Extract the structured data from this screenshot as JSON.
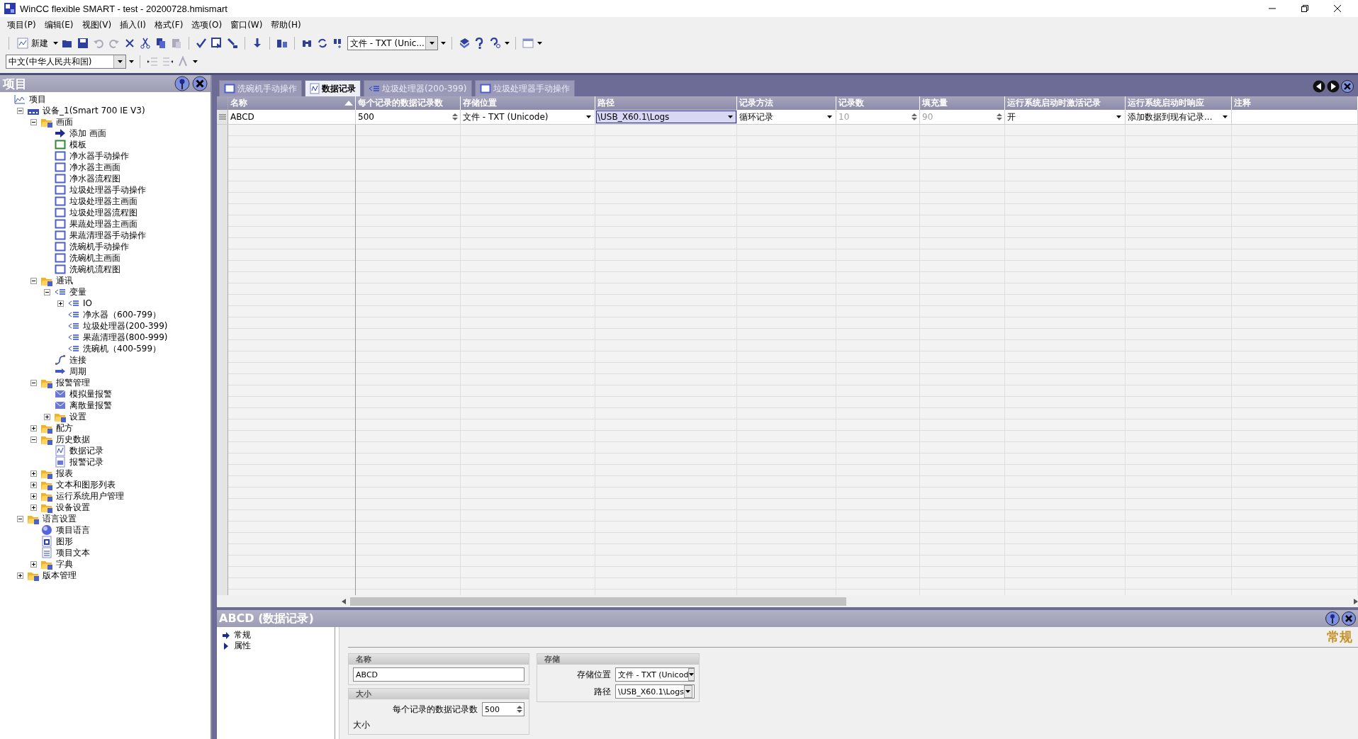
{
  "window": {
    "title": "WinCC flexible SMART - test - 20200728.hmismart"
  },
  "menu": [
    "项目(P)",
    "编辑(E)",
    "视图(V)",
    "插入(I)",
    "格式(F)",
    "选项(O)",
    "窗口(W)",
    "帮助(H)"
  ],
  "toolbar": {
    "new_label": "新建",
    "storage_combo": "文件 - TXT (Unic...",
    "language_combo": "中文(中华人民共和国)"
  },
  "project_panel": {
    "title": "项目",
    "tree": [
      {
        "label": "项目",
        "kind": "project",
        "children": [
          {
            "label": "设备_1(Smart 700 IE V3)",
            "kind": "device",
            "expanded": true,
            "children": [
              {
                "label": "画面",
                "kind": "folder",
                "expanded": true,
                "children": [
                  {
                    "label": "添加 画面",
                    "kind": "add"
                  },
                  {
                    "label": "模板",
                    "kind": "template"
                  },
                  {
                    "label": "净水器手动操作",
                    "kind": "screen"
                  },
                  {
                    "label": "净水器主画面",
                    "kind": "screen"
                  },
                  {
                    "label": "净水器流程图",
                    "kind": "screen"
                  },
                  {
                    "label": "垃圾处理器手动操作",
                    "kind": "screen"
                  },
                  {
                    "label": "垃圾处理器主画面",
                    "kind": "screen"
                  },
                  {
                    "label": "垃圾处理器流程图",
                    "kind": "screen"
                  },
                  {
                    "label": "果蔬处理器主画面",
                    "kind": "screen"
                  },
                  {
                    "label": "果蔬清理器手动操作",
                    "kind": "screen"
                  },
                  {
                    "label": "洗碗机手动操作",
                    "kind": "screen"
                  },
                  {
                    "label": "洗碗机主画面",
                    "kind": "screen"
                  },
                  {
                    "label": "洗碗机流程图",
                    "kind": "screen"
                  }
                ]
              },
              {
                "label": "通讯",
                "kind": "folder",
                "expanded": true,
                "children": [
                  {
                    "label": "变量",
                    "kind": "tags",
                    "expanded": true,
                    "children": [
                      {
                        "label": "IO",
                        "kind": "tags",
                        "expanded": false
                      },
                      {
                        "label": "净水器（600-799）",
                        "kind": "tags"
                      },
                      {
                        "label": "垃圾处理器(200-399)",
                        "kind": "tags"
                      },
                      {
                        "label": "果蔬清理器(800-999)",
                        "kind": "tags"
                      },
                      {
                        "label": "洗碗机（400-599）",
                        "kind": "tags"
                      }
                    ]
                  },
                  {
                    "label": "连接",
                    "kind": "connection"
                  },
                  {
                    "label": "周期",
                    "kind": "cycle"
                  }
                ]
              },
              {
                "label": "报警管理",
                "kind": "folder",
                "expanded": true,
                "children": [
                  {
                    "label": "模拟量报警",
                    "kind": "alarm"
                  },
                  {
                    "label": "离散量报警",
                    "kind": "alarm"
                  },
                  {
                    "label": "设置",
                    "kind": "folder",
                    "expanded": false
                  }
                ]
              },
              {
                "label": "配方",
                "kind": "folder",
                "expanded": false
              },
              {
                "label": "历史数据",
                "kind": "folder",
                "expanded": true,
                "children": [
                  {
                    "label": "数据记录",
                    "kind": "log"
                  },
                  {
                    "label": "报警记录",
                    "kind": "alarmlog"
                  }
                ]
              },
              {
                "label": "报表",
                "kind": "folder",
                "expanded": false
              },
              {
                "label": "文本和图形列表",
                "kind": "folder",
                "expanded": false
              },
              {
                "label": "运行系统用户管理",
                "kind": "folder",
                "expanded": false
              },
              {
                "label": "设备设置",
                "kind": "folder",
                "expanded": false
              }
            ]
          },
          {
            "label": "语言设置",
            "kind": "folder",
            "expanded": true,
            "children": [
              {
                "label": "项目语言",
                "kind": "globe"
              },
              {
                "label": "图形",
                "kind": "graphic"
              },
              {
                "label": "项目文本",
                "kind": "doc"
              },
              {
                "label": "字典",
                "kind": "folder",
                "expanded": false
              }
            ]
          },
          {
            "label": "版本管理",
            "kind": "folder",
            "expanded": false
          }
        ]
      }
    ]
  },
  "tabs": [
    {
      "label": "洗碗机手动操作",
      "kind": "screen",
      "selected": false
    },
    {
      "label": "数据记录",
      "kind": "log",
      "selected": true
    },
    {
      "label": "垃圾处理器(200-399)",
      "kind": "tags",
      "selected": false
    },
    {
      "label": "垃圾处理器手动操作",
      "kind": "screen",
      "selected": false
    }
  ],
  "table": {
    "columns": [
      {
        "label": "名称",
        "sorted": true
      },
      {
        "label": "每个记录的数据记录数",
        "sorted": false
      },
      {
        "label": "存储位置",
        "sorted": false
      },
      {
        "label": "路径",
        "sorted": false
      },
      {
        "label": "记录方法",
        "sorted": false
      },
      {
        "label": "记录数",
        "sorted": false
      },
      {
        "label": "填充量",
        "sorted": false
      },
      {
        "label": "运行系统启动时激活记录",
        "sorted": false
      },
      {
        "label": "运行系统启动时响应",
        "sorted": false
      },
      {
        "label": "注释",
        "sorted": false
      }
    ],
    "rows": [
      {
        "cells": [
          {
            "kind": "text",
            "value": "ABCD",
            "selected": false,
            "disabled": false
          },
          {
            "kind": "spin",
            "value": "500",
            "selected": false,
            "disabled": false
          },
          {
            "kind": "combo",
            "value": "文件 - TXT (Unicode)",
            "selected": false,
            "disabled": false
          },
          {
            "kind": "combo",
            "value": "\\USB_X60.1\\Logs",
            "selected": true,
            "disabled": false
          },
          {
            "kind": "combo",
            "value": "循环记录",
            "selected": false,
            "disabled": false
          },
          {
            "kind": "spin",
            "value": "10",
            "selected": false,
            "disabled": true
          },
          {
            "kind": "spin",
            "value": "90",
            "selected": false,
            "disabled": true
          },
          {
            "kind": "combo",
            "value": "开",
            "selected": false,
            "disabled": false
          },
          {
            "kind": "combo",
            "value": "添加数据到现有记录...",
            "selected": false,
            "disabled": false
          },
          {
            "kind": "text",
            "selected": false
          }
        ]
      }
    ]
  },
  "properties": {
    "title": "ABCD (数据记录)",
    "nav": [
      {
        "label": "常规",
        "selected": true
      },
      {
        "label": "属性",
        "selected": false
      }
    ],
    "heading": "常规",
    "name_group": {
      "title": "名称",
      "value": "ABCD"
    },
    "size_group": {
      "title": "大小",
      "fields": [
        {
          "label": "每个记录的数据记录数",
          "value": "500",
          "kind": "spin"
        }
      ],
      "note": "大小"
    },
    "storage_group": {
      "title": "存储",
      "fields": [
        {
          "label": "存储位置",
          "value": "文件 - TXT (Unicod",
          "kind": "combo"
        },
        {
          "label": "路径",
          "value": "\\USB_X60.1\\Logs",
          "kind": "combo"
        }
      ]
    }
  }
}
